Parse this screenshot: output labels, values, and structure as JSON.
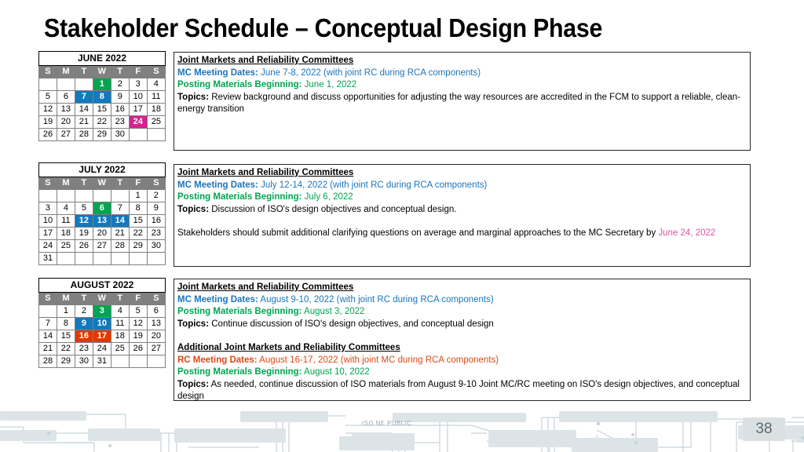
{
  "slide": {
    "title": "Stakeholder Schedule – Conceptual Design Phase",
    "page_number": "38",
    "footer_label": "ISO NE PUBLIC"
  },
  "colors": {
    "green": "#00A550",
    "blue": "#1279BE",
    "magenta": "#D6218F",
    "red": "#DD3908",
    "dow_header_bg": "#808080",
    "mc_text": "#1B75BB",
    "rc_text": "#DD4814",
    "posting_text": "#00A550",
    "pink_date": "#E0559E"
  },
  "calendars": [
    {
      "name": "june",
      "title": "JUNE 2022",
      "dow": [
        "S",
        "M",
        "T",
        "W",
        "T",
        "F",
        "S"
      ],
      "weeks": [
        [
          {
            "d": "",
            "h": ""
          },
          {
            "d": "",
            "h": ""
          },
          {
            "d": "",
            "h": ""
          },
          {
            "d": "1",
            "h": "green"
          },
          {
            "d": "2",
            "h": ""
          },
          {
            "d": "3",
            "h": ""
          },
          {
            "d": "4",
            "h": ""
          }
        ],
        [
          {
            "d": "5",
            "h": ""
          },
          {
            "d": "6",
            "h": ""
          },
          {
            "d": "7",
            "h": "blue"
          },
          {
            "d": "8",
            "h": "blue"
          },
          {
            "d": "9",
            "h": ""
          },
          {
            "d": "10",
            "h": ""
          },
          {
            "d": "11",
            "h": ""
          }
        ],
        [
          {
            "d": "12",
            "h": ""
          },
          {
            "d": "13",
            "h": ""
          },
          {
            "d": "14",
            "h": ""
          },
          {
            "d": "15",
            "h": ""
          },
          {
            "d": "16",
            "h": ""
          },
          {
            "d": "17",
            "h": ""
          },
          {
            "d": "18",
            "h": ""
          }
        ],
        [
          {
            "d": "19",
            "h": ""
          },
          {
            "d": "20",
            "h": ""
          },
          {
            "d": "21",
            "h": ""
          },
          {
            "d": "22",
            "h": ""
          },
          {
            "d": "23",
            "h": ""
          },
          {
            "d": "24",
            "h": "magenta"
          },
          {
            "d": "25",
            "h": ""
          }
        ],
        [
          {
            "d": "26",
            "h": ""
          },
          {
            "d": "27",
            "h": ""
          },
          {
            "d": "28",
            "h": ""
          },
          {
            "d": "29",
            "h": ""
          },
          {
            "d": "30",
            "h": ""
          },
          {
            "d": "",
            "h": ""
          },
          {
            "d": "",
            "h": ""
          }
        ]
      ]
    },
    {
      "name": "july",
      "title": "JULY 2022",
      "dow": [
        "S",
        "M",
        "T",
        "W",
        "T",
        "F",
        "S"
      ],
      "weeks": [
        [
          {
            "d": "",
            "h": ""
          },
          {
            "d": "",
            "h": ""
          },
          {
            "d": "",
            "h": ""
          },
          {
            "d": "",
            "h": ""
          },
          {
            "d": "",
            "h": ""
          },
          {
            "d": "1",
            "h": ""
          },
          {
            "d": "2",
            "h": ""
          }
        ],
        [
          {
            "d": "3",
            "h": ""
          },
          {
            "d": "4",
            "h": ""
          },
          {
            "d": "5",
            "h": ""
          },
          {
            "d": "6",
            "h": "green"
          },
          {
            "d": "7",
            "h": ""
          },
          {
            "d": "8",
            "h": ""
          },
          {
            "d": "9",
            "h": ""
          }
        ],
        [
          {
            "d": "10",
            "h": ""
          },
          {
            "d": "11",
            "h": ""
          },
          {
            "d": "12",
            "h": "blue"
          },
          {
            "d": "13",
            "h": "blue"
          },
          {
            "d": "14",
            "h": "blue"
          },
          {
            "d": "15",
            "h": ""
          },
          {
            "d": "16",
            "h": ""
          }
        ],
        [
          {
            "d": "17",
            "h": ""
          },
          {
            "d": "18",
            "h": ""
          },
          {
            "d": "19",
            "h": ""
          },
          {
            "d": "20",
            "h": ""
          },
          {
            "d": "21",
            "h": ""
          },
          {
            "d": "22",
            "h": ""
          },
          {
            "d": "23",
            "h": ""
          }
        ],
        [
          {
            "d": "24",
            "h": ""
          },
          {
            "d": "25",
            "h": ""
          },
          {
            "d": "26",
            "h": ""
          },
          {
            "d": "27",
            "h": ""
          },
          {
            "d": "28",
            "h": ""
          },
          {
            "d": "29",
            "h": ""
          },
          {
            "d": "30",
            "h": ""
          }
        ],
        [
          {
            "d": "31",
            "h": ""
          },
          {
            "d": "",
            "h": ""
          },
          {
            "d": "",
            "h": ""
          },
          {
            "d": "",
            "h": ""
          },
          {
            "d": "",
            "h": ""
          },
          {
            "d": "",
            "h": ""
          },
          {
            "d": "",
            "h": ""
          }
        ]
      ]
    },
    {
      "name": "august",
      "title": "AUGUST 2022",
      "dow": [
        "S",
        "M",
        "T",
        "W",
        "T",
        "F",
        "S"
      ],
      "weeks": [
        [
          {
            "d": "",
            "h": ""
          },
          {
            "d": "1",
            "h": ""
          },
          {
            "d": "2",
            "h": ""
          },
          {
            "d": "3",
            "h": "green"
          },
          {
            "d": "4",
            "h": ""
          },
          {
            "d": "5",
            "h": ""
          },
          {
            "d": "6",
            "h": ""
          }
        ],
        [
          {
            "d": "7",
            "h": ""
          },
          {
            "d": "8",
            "h": ""
          },
          {
            "d": "9",
            "h": "blue"
          },
          {
            "d": "10",
            "h": "blue"
          },
          {
            "d": "11",
            "h": ""
          },
          {
            "d": "12",
            "h": ""
          },
          {
            "d": "13",
            "h": ""
          }
        ],
        [
          {
            "d": "14",
            "h": ""
          },
          {
            "d": "15",
            "h": ""
          },
          {
            "d": "16",
            "h": "red"
          },
          {
            "d": "17",
            "h": "red"
          },
          {
            "d": "18",
            "h": ""
          },
          {
            "d": "19",
            "h": ""
          },
          {
            "d": "20",
            "h": ""
          }
        ],
        [
          {
            "d": "21",
            "h": ""
          },
          {
            "d": "22",
            "h": ""
          },
          {
            "d": "23",
            "h": ""
          },
          {
            "d": "24",
            "h": ""
          },
          {
            "d": "25",
            "h": ""
          },
          {
            "d": "26",
            "h": ""
          },
          {
            "d": "27",
            "h": ""
          }
        ],
        [
          {
            "d": "28",
            "h": ""
          },
          {
            "d": "29",
            "h": ""
          },
          {
            "d": "30",
            "h": ""
          },
          {
            "d": "31",
            "h": ""
          },
          {
            "d": "",
            "h": ""
          },
          {
            "d": "",
            "h": ""
          },
          {
            "d": "",
            "h": ""
          }
        ]
      ]
    }
  ],
  "boxes": {
    "june": {
      "heading": "Joint Markets and Reliability Committees",
      "mc_label": "MC Meeting Dates:",
      "mc_value": " June 7-8, 2022 (with joint RC during RCA components)",
      "posting_label": "Posting Materials Beginning:",
      "posting_value": " June 1, 2022",
      "topics_label": "Topics:",
      "topics_value": " Review background and discuss opportunities for adjusting the way resources are accredited in the FCM to support a reliable, clean-energy transition"
    },
    "july": {
      "heading": "Joint Markets and Reliability Committees",
      "mc_label": "MC Meeting Dates:",
      "mc_value": " July 12-14, 2022 (with joint RC during RCA components)",
      "posting_label": "Posting Materials Beginning:",
      "posting_value": " July 6, 2022",
      "topics_label": "Topics:",
      "topics_value": " Discussion of ISO's design objectives and conceptual design.",
      "note_text": "Stakeholders should submit additional clarifying questions on average and marginal approaches to the MC Secretary by ",
      "note_date": "June 24, 2022"
    },
    "august": {
      "heading": "Joint Markets and Reliability Committees",
      "mc_label": "MC Meeting Dates:",
      "mc_value": " August 9-10, 2022 (with joint RC during RCA components)",
      "posting_label": "Posting Materials Beginning:",
      "posting_value": " August 3, 2022",
      "topics_label": "Topics:",
      "topics_value": " Continue discussion of ISO's design objectives, and conceptual design",
      "heading2": "Additional Joint Markets and Reliability Committees",
      "rc_label": "RC Meeting Dates:",
      "rc_value": " August 16-17, 2022 (with joint MC during RCA components)",
      "posting2_label": "Posting Materials Beginning:",
      "posting2_value": " August 10, 2022",
      "topics2_label": "Topics:",
      "topics2_value": " As needed, continue discussion of ISO materials from August 9-10 Joint MC/RC meeting on ISO's design objectives, and conceptual design"
    }
  }
}
